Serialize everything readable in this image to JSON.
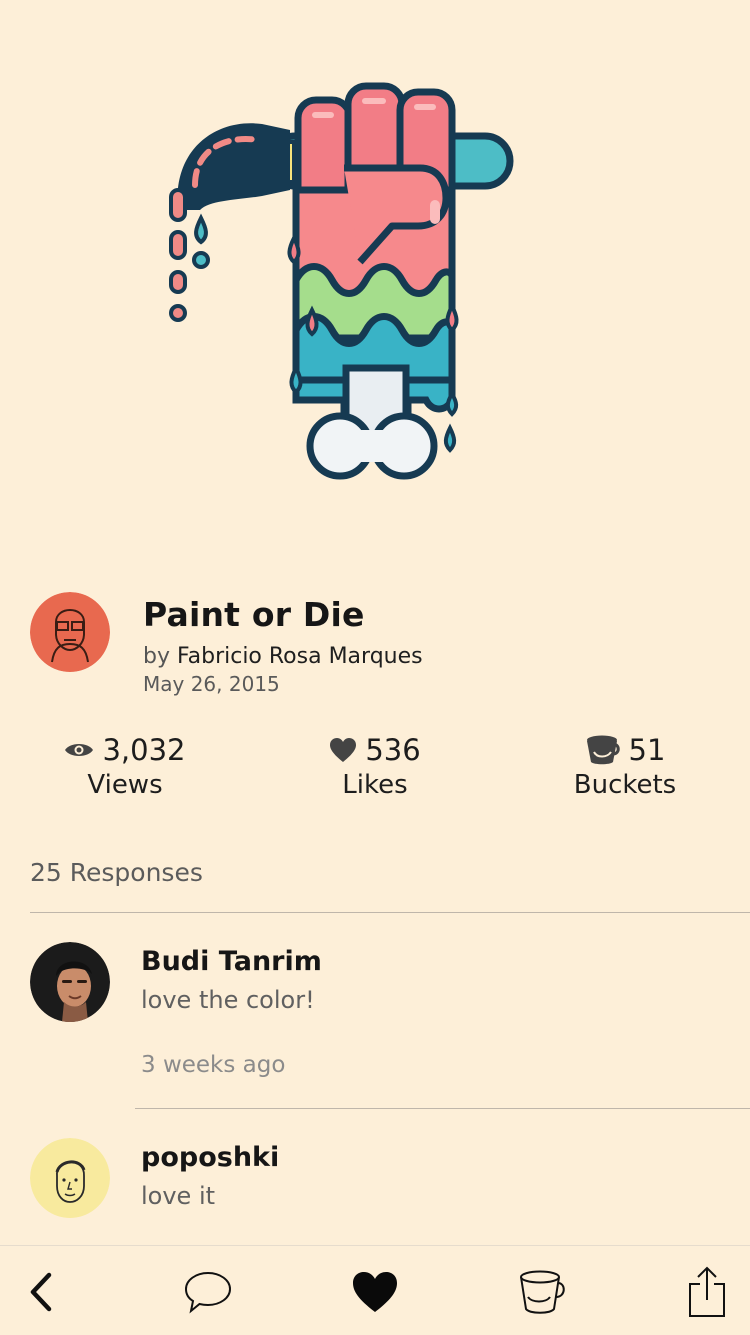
{
  "shot": {
    "title": "Paint or Die"
  },
  "author": {
    "by": "by",
    "name": "Fabricio Rosa Marques",
    "date": "May 26, 2015"
  },
  "stats": {
    "views": {
      "value": "3,032",
      "label": "Views",
      "icon": "eye-icon"
    },
    "likes": {
      "value": "536",
      "label": "Likes",
      "icon": "heart-icon"
    },
    "buckets": {
      "value": "51",
      "label": "Buckets",
      "icon": "bucket-icon"
    }
  },
  "responses": {
    "count_label": "25 Responses",
    "items": [
      {
        "name": "Budi Tanrim",
        "text": "love the color!",
        "time": "3 weeks ago"
      },
      {
        "name": "poposhki",
        "text": "love it"
      }
    ]
  },
  "tabbar": {
    "items": [
      "back-chevron-icon",
      "comment-bubble-icon",
      "heart-filled-icon",
      "bucket-icon",
      "share-icon"
    ]
  },
  "colors": {
    "background": "#fdefd8",
    "author_avatar_bg": "#e8694f",
    "commenter2_avatar_bg": "#f8ea9e",
    "dark_outline": "#163a52"
  }
}
